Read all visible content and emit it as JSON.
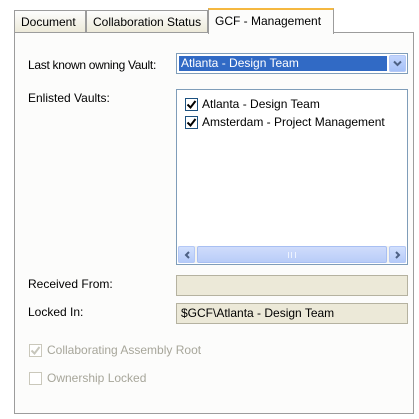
{
  "tabs": [
    {
      "label": "Document"
    },
    {
      "label": "Collaboration Status"
    },
    {
      "label": "GCF - Management"
    }
  ],
  "owning_vault": {
    "label": "Last known owning Vault:",
    "value": "Atlanta - Design Team"
  },
  "enlisted_vaults": {
    "label": "Enlisted Vaults:",
    "items": [
      {
        "label": "Atlanta - Design Team",
        "checked": true
      },
      {
        "label": "Amsterdam - Project Management",
        "checked": true
      }
    ]
  },
  "received_from": {
    "label": "Received From:",
    "value": ""
  },
  "locked_in": {
    "label": "Locked In:",
    "value": "$GCF\\Atlanta - Design Team"
  },
  "options": {
    "collaborating_root": {
      "label": "Collaborating Assembly Root",
      "checked": true,
      "enabled": false
    },
    "ownership_locked": {
      "label": "Ownership Locked",
      "checked": false,
      "enabled": false
    }
  },
  "icons": {
    "dropdown": "chevron-down-icon",
    "scroll_left": "arrow-left-icon",
    "scroll_right": "arrow-right-icon",
    "checkmark": "checkmark-icon"
  },
  "colors": {
    "selection": "#316ac5",
    "active_tab_accent": "#f5b840",
    "disabled_text": "#a7a69a"
  }
}
